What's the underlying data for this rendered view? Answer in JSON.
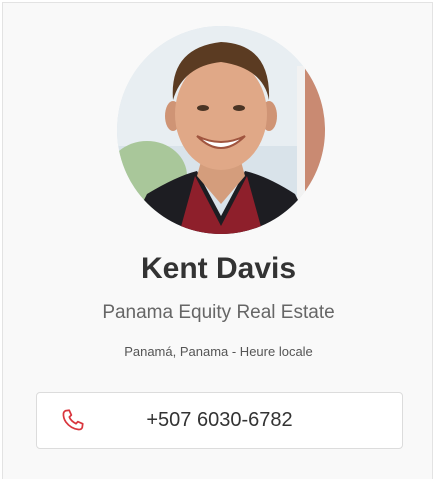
{
  "agent": {
    "name": "Kent Davis",
    "company": "Panama Equity Real Estate",
    "location": "Panamá, Panama - Heure locale",
    "phone": "+507 6030-6782"
  },
  "icons": {
    "phone": "phone-icon"
  },
  "colors": {
    "phone_icon": "#d9363e",
    "name_text": "#333333",
    "card_bg": "#f9f9f9"
  }
}
